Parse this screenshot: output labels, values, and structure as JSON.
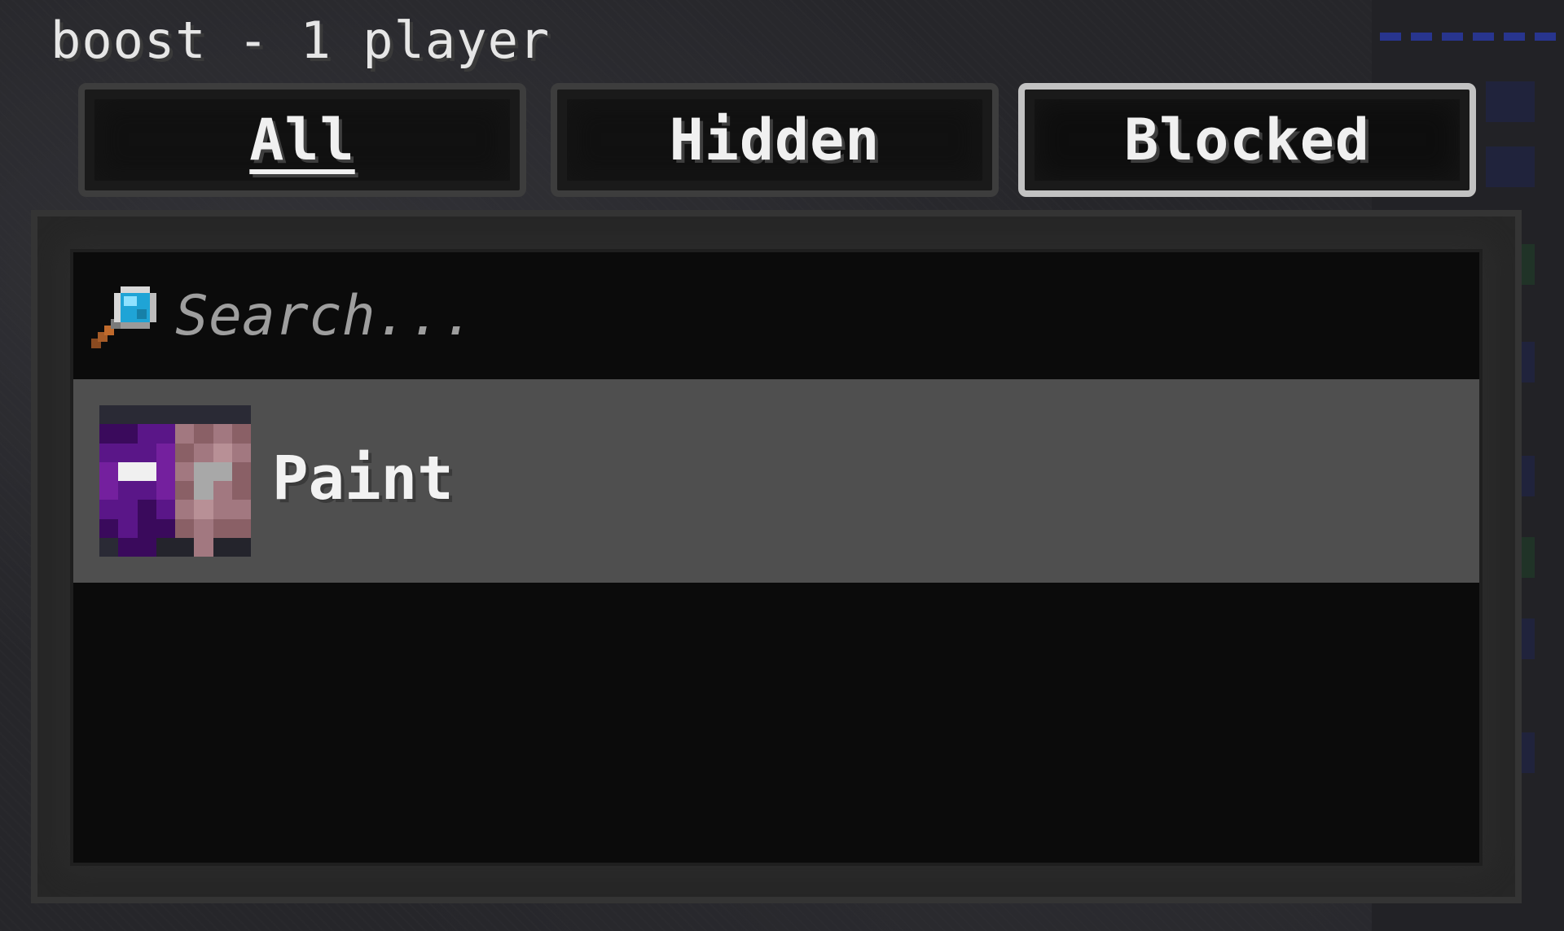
{
  "window": {
    "title": "boost - 1 player"
  },
  "tabs": [
    {
      "label": "All",
      "active": false,
      "underlined": true
    },
    {
      "label": "Hidden",
      "active": false,
      "underlined": false
    },
    {
      "label": "Blocked",
      "active": true,
      "underlined": false
    }
  ],
  "search": {
    "placeholder": "Search...",
    "value": "",
    "icon": "magnifying-glass-icon"
  },
  "players": [
    {
      "name": "Paint",
      "avatar_icon": "player-head-avatar"
    }
  ],
  "colors": {
    "active_tab_border": "#c2c2c2",
    "selected_row": "#4f4f4f",
    "list_background": "#0b0b0b",
    "text": "#f0f0f0",
    "placeholder_text": "#9e9e9e"
  }
}
